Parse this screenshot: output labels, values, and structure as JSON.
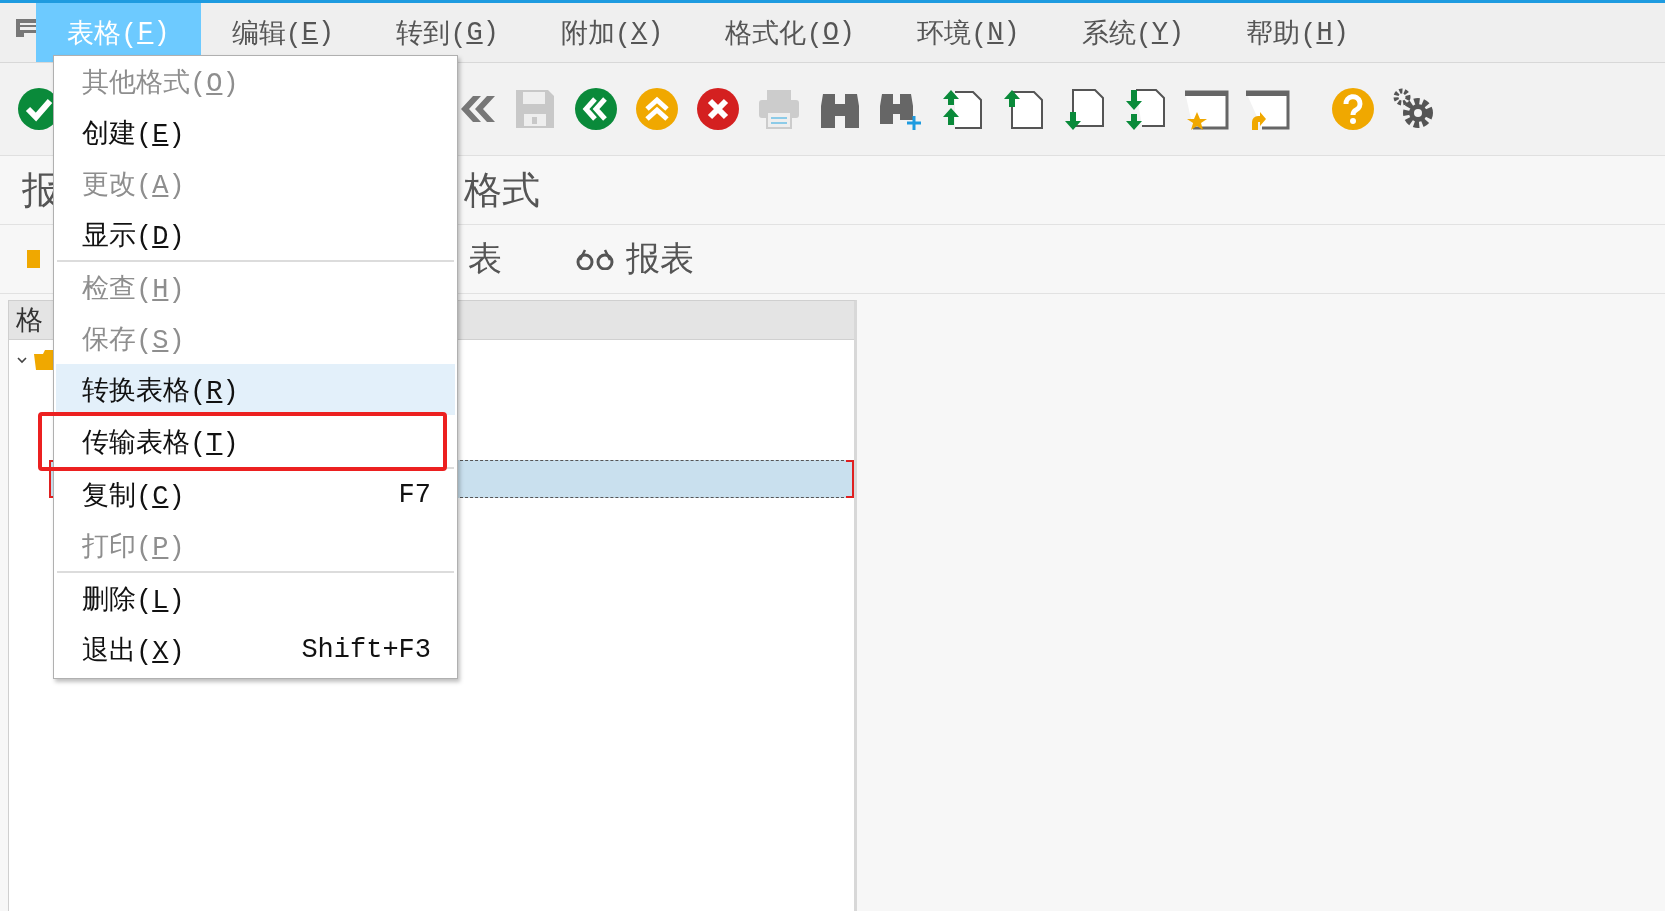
{
  "menu_bar": {
    "items": [
      {
        "label": "表格(F)",
        "selected": true
      },
      {
        "label": "编辑(E)",
        "selected": false
      },
      {
        "label": "转到(G)",
        "selected": false
      },
      {
        "label": "附加(X)",
        "selected": false
      },
      {
        "label": "格式化(O)",
        "selected": false
      },
      {
        "label": "环境(N)",
        "selected": false
      },
      {
        "label": "系统(Y)",
        "selected": false
      },
      {
        "label": "帮助(H)",
        "selected": false
      }
    ]
  },
  "title": {
    "start": "报",
    "end": "格式"
  },
  "tab_row": {
    "text": "表",
    "button": "报表"
  },
  "tree": {
    "column_header": "格",
    "nodes": [
      {
        "expanded": true,
        "children": [
          {
            "selected": true
          }
        ]
      }
    ]
  },
  "dropdown": {
    "items": [
      {
        "kind": "item",
        "label": "其他格式(O)",
        "disabled": true,
        "hovered": false,
        "boxed": false
      },
      {
        "kind": "item",
        "label": "创建(E)",
        "disabled": false,
        "hovered": false,
        "boxed": false
      },
      {
        "kind": "item",
        "label": "更改(A)",
        "disabled": true,
        "hovered": false,
        "boxed": false
      },
      {
        "kind": "item",
        "label": "显示(D)",
        "disabled": false,
        "hovered": false,
        "boxed": false
      },
      {
        "kind": "separator"
      },
      {
        "kind": "item",
        "label": "检查(H)",
        "disabled": true,
        "hovered": false,
        "boxed": false
      },
      {
        "kind": "item",
        "label": "保存(S)",
        "disabled": true,
        "hovered": false,
        "boxed": false
      },
      {
        "kind": "item",
        "label": "转换表格(R)",
        "disabled": false,
        "hovered": true,
        "boxed": false
      },
      {
        "kind": "item",
        "label": "传输表格(T)",
        "disabled": false,
        "hovered": false,
        "boxed": true
      },
      {
        "kind": "separator"
      },
      {
        "kind": "item",
        "label": "复制(C)",
        "shortcut": "F7",
        "disabled": false,
        "hovered": false,
        "boxed": false
      },
      {
        "kind": "item",
        "label": "打印(P)",
        "disabled": true,
        "hovered": false,
        "boxed": false
      },
      {
        "kind": "separator"
      },
      {
        "kind": "item",
        "label": "删除(L)",
        "disabled": false,
        "hovered": false,
        "boxed": false
      },
      {
        "kind": "item",
        "label": "退出(X)",
        "shortcut": "Shift+F3",
        "disabled": false,
        "hovered": false,
        "boxed": false
      }
    ]
  }
}
